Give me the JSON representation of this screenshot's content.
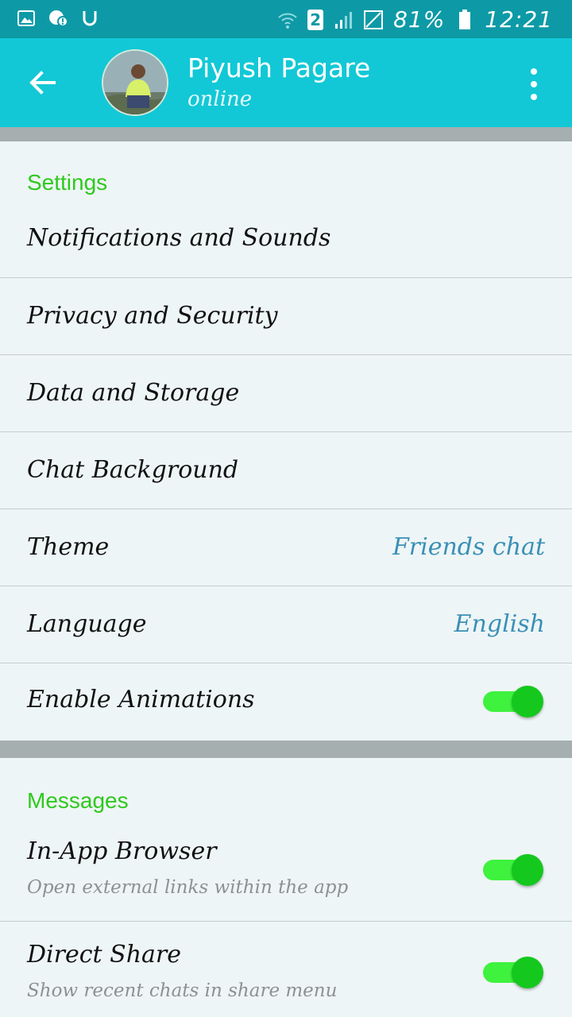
{
  "status_bar": {
    "battery": "81%",
    "time": "12:21",
    "sim": "2",
    "left_icons": [
      "gallery-icon",
      "chat-alert-icon",
      "u-icon"
    ],
    "right_icons": [
      "wifi-icon",
      "sim-2-icon",
      "signal-icon",
      "no-signal-icon",
      "battery-icon"
    ]
  },
  "header": {
    "title": "Piyush Pagare",
    "subtitle": "online"
  },
  "sections": {
    "settings": {
      "title": "Settings",
      "items": [
        {
          "label": "Notifications and Sounds"
        },
        {
          "label": "Privacy and Security"
        },
        {
          "label": "Data and Storage"
        },
        {
          "label": "Chat Background"
        },
        {
          "label": "Theme",
          "value": "Friends chat"
        },
        {
          "label": "Language",
          "value": "English"
        },
        {
          "label": "Enable Animations",
          "toggle": true
        }
      ]
    },
    "messages": {
      "title": "Messages",
      "items": [
        {
          "label": "In-App Browser",
          "description": "Open external links within the app",
          "toggle": true
        },
        {
          "label": "Direct Share",
          "description": "Show recent chats in share menu",
          "toggle": true
        }
      ]
    }
  },
  "colors": {
    "status_bar": "#0d9aa6",
    "app_bar": "#12c8d6",
    "section_title": "#2ec91e",
    "value_text": "#3a90b6",
    "toggle_on": "#14c81e"
  }
}
